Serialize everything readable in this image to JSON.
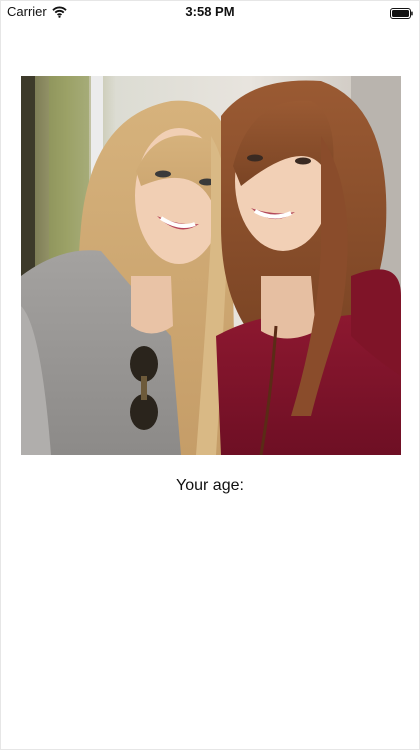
{
  "status_bar": {
    "carrier": "Carrier",
    "time": "3:58 PM",
    "wifi_icon": "wifi-icon",
    "battery_icon": "battery-icon"
  },
  "main": {
    "photo_icon": "selfie-photo",
    "age_label": "Your age:"
  }
}
